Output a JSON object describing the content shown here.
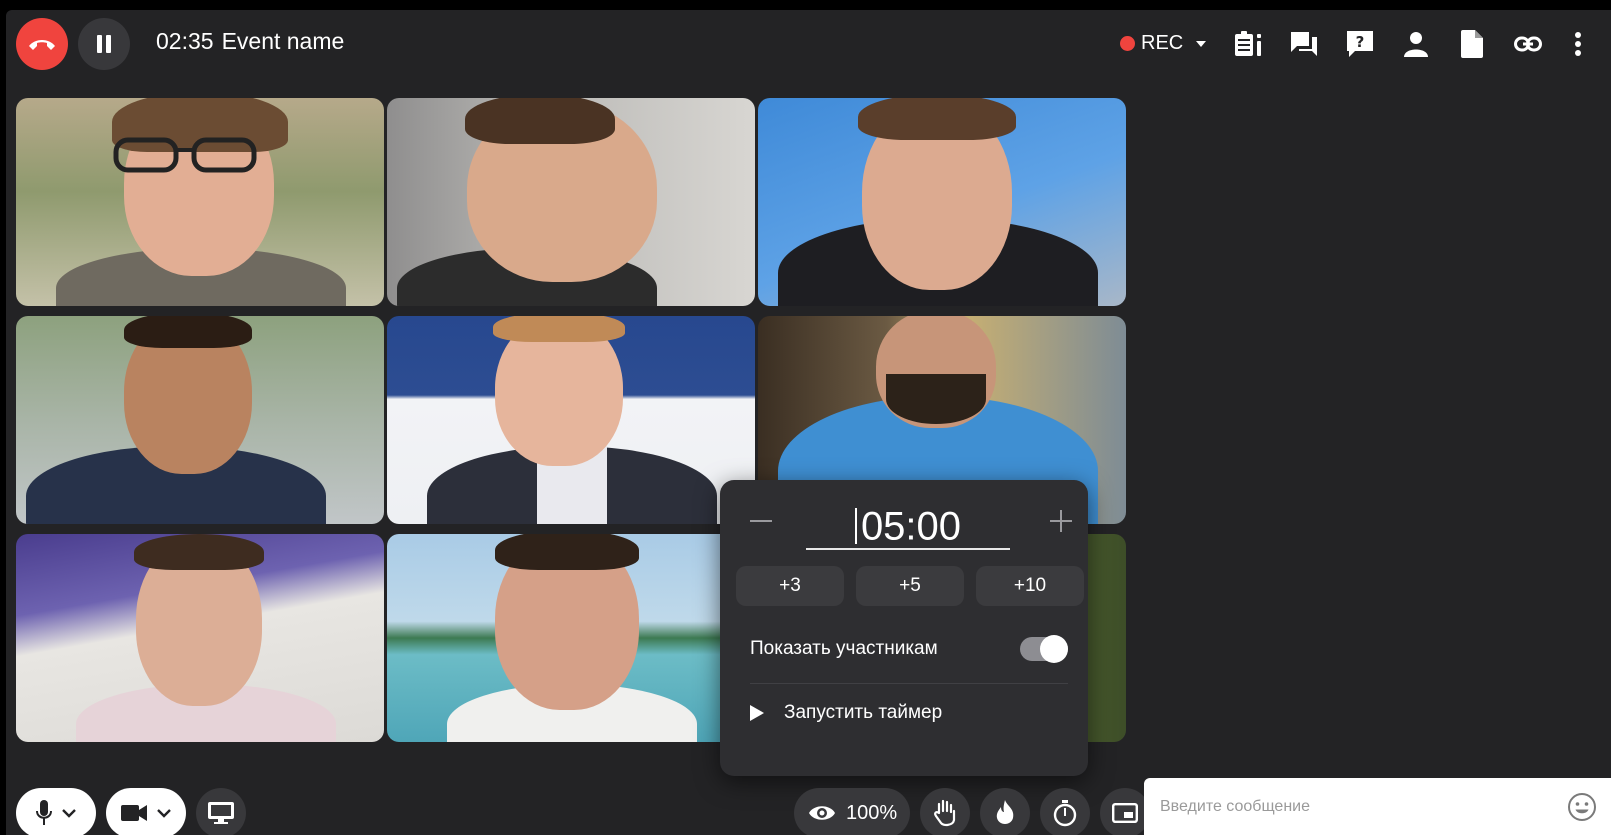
{
  "header": {
    "elapsed": "02:35",
    "event_name": "Event name",
    "rec_label": "REC"
  },
  "timer": {
    "value": "05:00",
    "presets": [
      "+3",
      "+5",
      "+10"
    ],
    "show_label": "Показать участникам",
    "show_enabled": true,
    "start_label": "Запустить таймер"
  },
  "controls": {
    "zoom": "100%"
  },
  "chat": {
    "placeholder": "Введите сообщение"
  },
  "colors": {
    "accent_red": "#f0443e",
    "surface": "#232325",
    "popup": "#2e2e31"
  }
}
